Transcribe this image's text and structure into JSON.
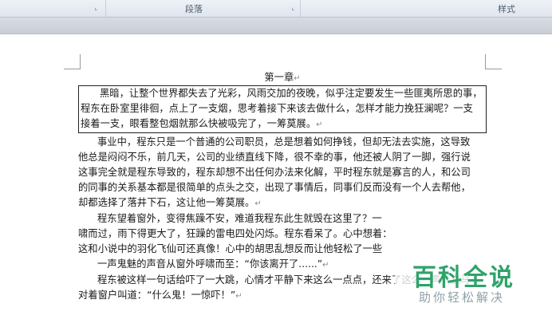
{
  "ribbon": {
    "group_paragraph": "段落",
    "group_styles": "样式",
    "launcher_glyph": "⌞"
  },
  "document": {
    "title": "第一章",
    "boxed_lines": [
      "黑暗，让整个世界都失去了光彩，风雨交加的夜晚，似乎注定要发生一些匪夷所思的事，",
      "程东在卧室里徘徊，点上了一支烟，思考着接下来该去做什么，怎样才能力挽狂澜呢？一支",
      "接着一支，眼看整包烟就那么快被吸完了，一筹莫展。"
    ],
    "para2_lines": [
      "事业中，程东只是一个普通的公司职员，总是想着如何挣钱，但却无法去实施，这导致",
      "他总是闷闷不乐，前几天，公司的业绩直线下降，很不幸的事，他还被人阴了一脚，强行说",
      "这事完全就是程东导致的，程东却想不出任何办法来化解，平时程东就是寡言的人，和公司",
      "的同事的关系基本都是很简单的点头之交，出现了事情后，同事们反而没有一个人去帮他，",
      "却都选择了落井下石，这让他一筹莫展。"
    ],
    "para3_lines": [
      "程东望着窗外，变得焦躁不安，难道我程东此生就毁在这里了？一",
      "啸而过，雨下得更大了，狂躁的雷电四处闪烁。程东看呆了。心中想着：",
      "这和小说中的羽化飞仙可还真像！心中的胡思乱想反而让他轻松了一些"
    ],
    "para4_line": "一声鬼魅的声音从窗外呼啸而至：“你该离开了......”",
    "para5_lines": [
      "程东被这样一句话给吓了一大跳，心情才平静下来这么一点点，还来了这么一声，立马",
      "对着窗户叫道：“什么鬼！一惊吓！”"
    ],
    "para_mark": "↵"
  },
  "watermark": {
    "title": "百科全说",
    "subtitle": "助你轻松解决"
  }
}
